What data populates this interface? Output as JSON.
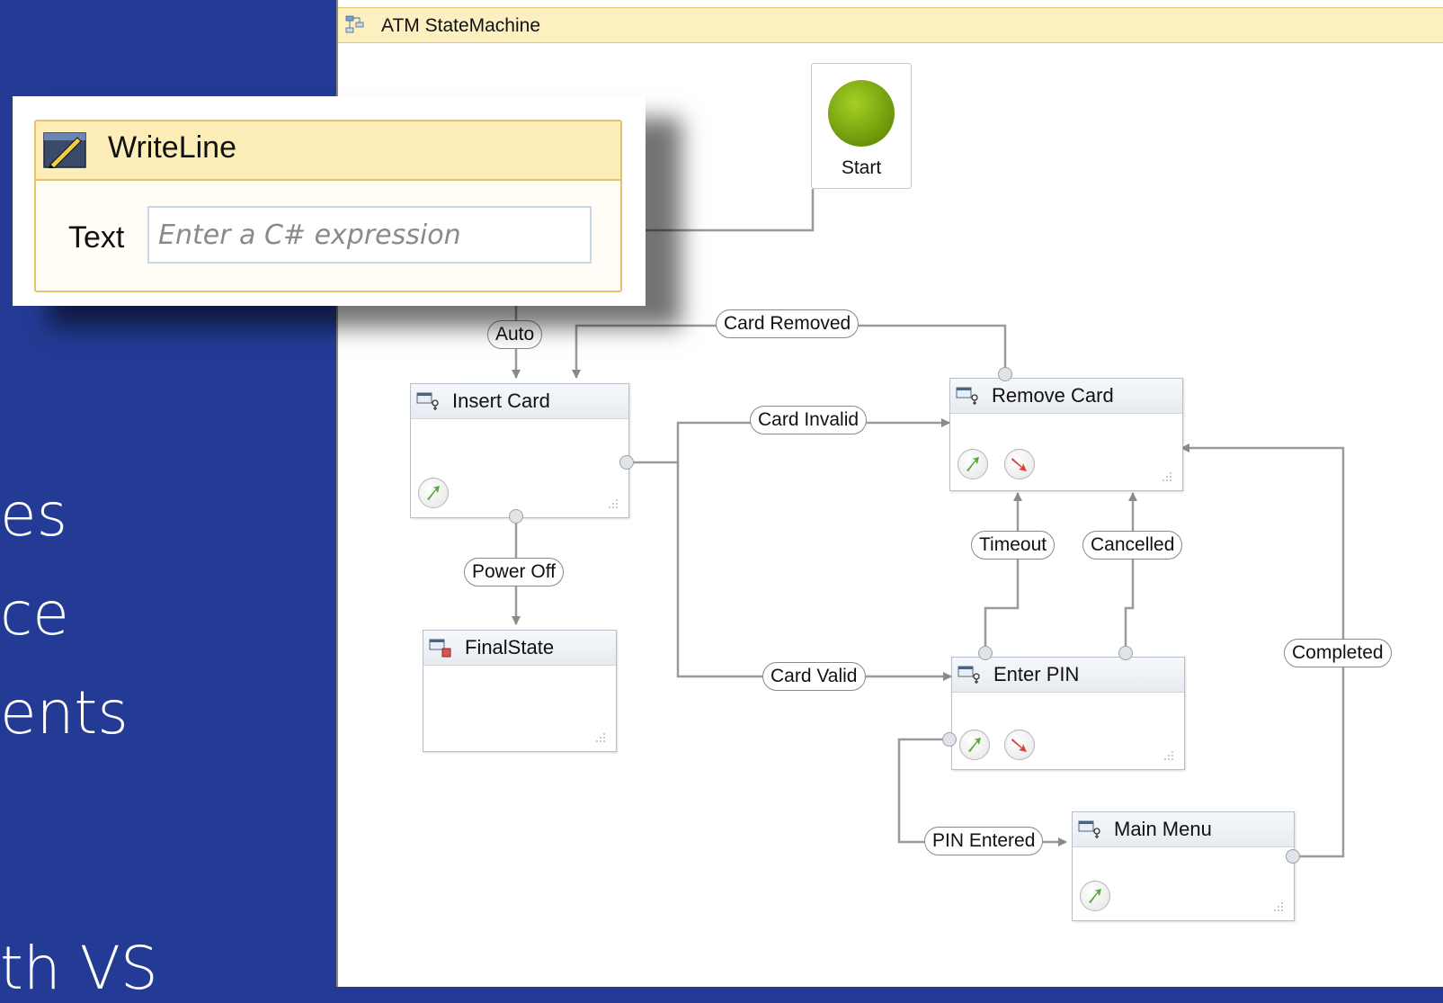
{
  "background": {
    "color": "#233b94",
    "text_fragments": [
      "es",
      "ce",
      "ents",
      "th VS"
    ]
  },
  "designer": {
    "title": "ATM StateMachine",
    "icon": "state-machine-icon",
    "start_label": "Start",
    "states": [
      {
        "id": "insert-card",
        "name": "Insert Card",
        "icon": "state-icon"
      },
      {
        "id": "final-state",
        "name": "FinalState",
        "icon": "final-state-icon"
      },
      {
        "id": "remove-card",
        "name": "Remove Card",
        "icon": "state-icon"
      },
      {
        "id": "enter-pin",
        "name": "Enter PIN",
        "icon": "state-icon"
      },
      {
        "id": "main-menu",
        "name": "Main Menu",
        "icon": "state-icon"
      }
    ],
    "transitions": [
      {
        "id": "auto",
        "label": "Auto"
      },
      {
        "id": "card-removed",
        "label": "Card Removed"
      },
      {
        "id": "card-invalid",
        "label": "Card Invalid"
      },
      {
        "id": "power-off",
        "label": "Power Off"
      },
      {
        "id": "timeout",
        "label": "Timeout"
      },
      {
        "id": "cancelled",
        "label": "Cancelled"
      },
      {
        "id": "card-valid",
        "label": "Card Valid"
      },
      {
        "id": "completed",
        "label": "Completed"
      },
      {
        "id": "pin-entered",
        "label": "PIN Entered"
      }
    ]
  },
  "writeline": {
    "title": "WriteLine",
    "icon": "writeline-icon",
    "field_label": "Text",
    "field_value": "",
    "field_placeholder": "Enter a C# expression"
  },
  "colors": {
    "slide_bg": "#233b94",
    "activity_header": "#fdeeb8",
    "activity_border": "#e6c06a",
    "start_green": "#7fae12"
  }
}
